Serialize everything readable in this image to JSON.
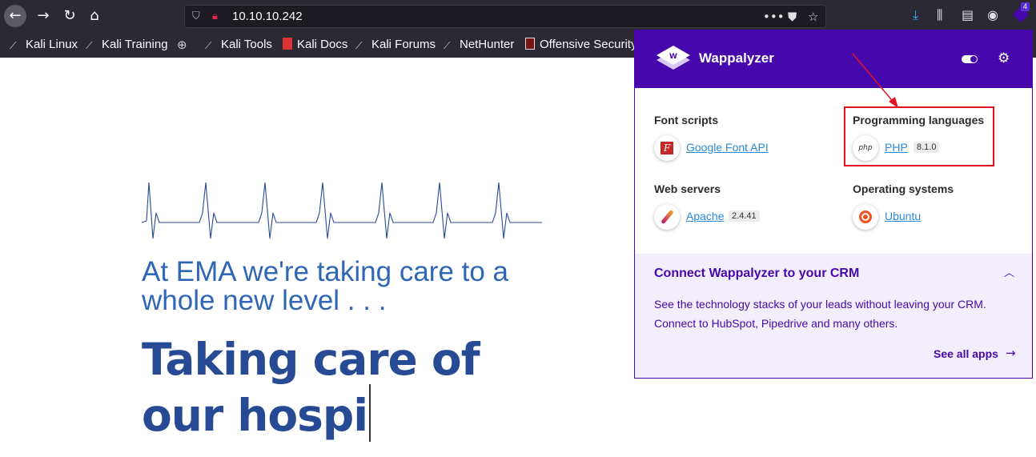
{
  "browser": {
    "url": "10.10.10.242",
    "extension_badge": "4",
    "icons": [
      "back-icon",
      "forward-icon",
      "reload-icon",
      "home-icon",
      "shield-icon",
      "insecure-lock-icon",
      "more-icon",
      "pocket-icon",
      "bookmark-star-icon",
      "download-icon",
      "library-icon",
      "reader-icon",
      "account-icon",
      "wappalyzer-extension-icon"
    ]
  },
  "bookmarks": [
    {
      "label": "Kali Linux",
      "icon": "kali-dragon-icon"
    },
    {
      "label": "Kali Training",
      "icon": "kali-dragon-icon"
    },
    {
      "label": "",
      "icon": "globe-icon"
    },
    {
      "label": "Kali Tools",
      "icon": "kali-dragon-icon"
    },
    {
      "label": "Kali Docs",
      "icon": "docs-icon"
    },
    {
      "label": "Kali Forums",
      "icon": "kali-dragon-icon"
    },
    {
      "label": "NetHunter",
      "icon": "kali-dragon-icon"
    },
    {
      "label": "Offensive Security",
      "icon": "offsec-icon"
    }
  ],
  "page": {
    "tagline": "At EMA we're taking care to a whole new level . . .",
    "headline": "Taking care of our hospi"
  },
  "wappalyzer": {
    "title": "Wappalyzer",
    "colors": {
      "brand": "#4608ad",
      "link": "#2b8ad8",
      "highlight_box": "#e5101d"
    },
    "categories": [
      {
        "name": "Font scripts",
        "tech": {
          "name": "Google Font API",
          "version": "",
          "icon": "google-font-icon"
        }
      },
      {
        "name": "Programming languages",
        "tech": {
          "name": "PHP",
          "version": "8.1.0",
          "icon": "php-icon"
        }
      },
      {
        "name": "Web servers",
        "tech": {
          "name": "Apache",
          "version": "2.4.41",
          "icon": "apache-feather-icon"
        }
      },
      {
        "name": "Operating systems",
        "tech": {
          "name": "Ubuntu",
          "version": "",
          "icon": "ubuntu-icon"
        }
      }
    ],
    "crm": {
      "title": "Connect Wappalyzer to your CRM",
      "text": "See the technology stacks of your leads without leaving your CRM. Connect to HubSpot, Pipedrive and many others.",
      "link": "See all apps"
    }
  }
}
